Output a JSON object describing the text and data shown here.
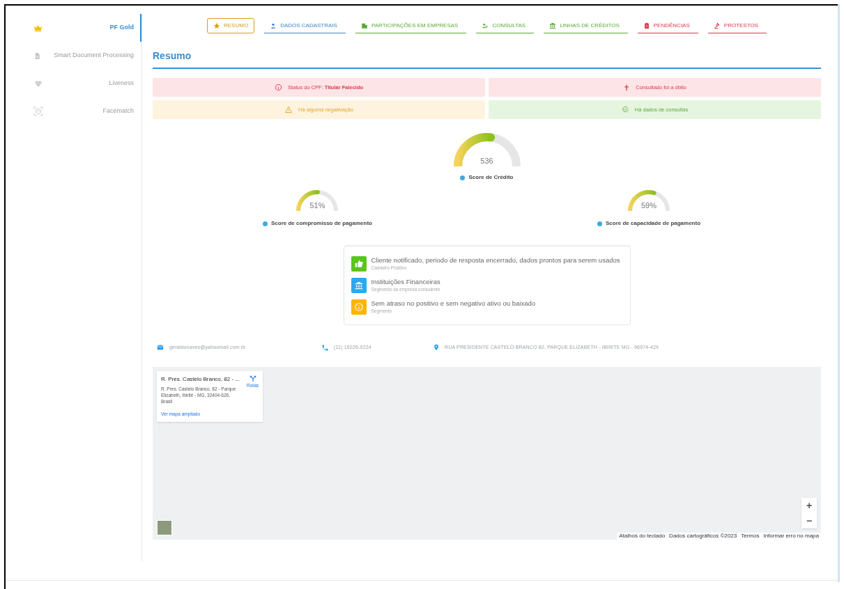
{
  "sidebar": {
    "items": [
      {
        "label": "PF Gold",
        "selected": true
      },
      {
        "label": "Smart Document Processing",
        "selected": false
      },
      {
        "label": "Liveness",
        "selected": false
      },
      {
        "label": "Facematch",
        "selected": false
      }
    ]
  },
  "tabs": [
    {
      "label": "RESUMO",
      "color": "#d4a017",
      "selected": true
    },
    {
      "label": "DADOS CADASTRAIS",
      "color": "#3b82c4",
      "selected": false
    },
    {
      "label": "PARTICIPAÇÕES EM EMPRESAS",
      "color": "#5aa832",
      "selected": false
    },
    {
      "label": "CONSULTAS",
      "color": "#5aa832",
      "selected": false
    },
    {
      "label": "LINHAS DE CRÉDITOS",
      "color": "#5aa832",
      "selected": false
    },
    {
      "label": "PENDÊNCIAS",
      "color": "#d9374b",
      "selected": false
    },
    {
      "label": "PROTESTOS",
      "color": "#d9374b",
      "selected": false
    }
  ],
  "section_title": "Resumo",
  "alerts": [
    {
      "kind": "danger",
      "text": "Status do CPF: **Titular Falecido**"
    },
    {
      "kind": "death",
      "text": "Consultado foi a óbito"
    },
    {
      "kind": "warning",
      "text": "Há alguma negativação"
    },
    {
      "kind": "success",
      "text": "Há dados de consultas"
    }
  ],
  "gauges": [
    {
      "value": "536",
      "label": "Score de Crédito",
      "level": 0.54
    },
    {
      "value": "51%",
      "label": "Score de compromisso de pagamento",
      "level": 0.51
    },
    {
      "value": "59%",
      "label": "Score de capacidade de pagamento",
      "level": 0.59
    }
  ],
  "info_list": [
    {
      "kind": "positive",
      "title": "Cliente notificado, periodo de resposta encerrado, dados prontos para serem usados",
      "subtitle": "Cadastro Positivo"
    },
    {
      "kind": "bank",
      "title": "Instituições Financeiras",
      "subtitle": "Segmento da empresa consulente"
    },
    {
      "kind": "info",
      "title": "Sem atraso no positivo e sem negativo ativo ou baixado",
      "subtitle": "Segmento"
    }
  ],
  "contact": {
    "email": "geraldonaves@yahoomail.com.br",
    "phone": "(11) 16226-9224",
    "address": "RUA PRESIDENTE CASTELO BRANCO 82, PARQUE ELIZABETH - IBIRITE MG - 96974-429"
  },
  "map": {
    "place_title": "R. Pres. Castelo Branco, 82 - ...",
    "place_address": "R. Pres. Castelo Branco, 82 - Parque Elizabeth, Ibirité - MG, 32404-626, Brasil",
    "directions": "Rotas",
    "larger_map": "Ver mapa ampliado",
    "zoom_in": "+",
    "zoom_out": "−",
    "attribution": [
      "Atalhos do teclado",
      "Dados cartográficos ©2023",
      "Termos",
      "Informar erro no mapa"
    ]
  }
}
